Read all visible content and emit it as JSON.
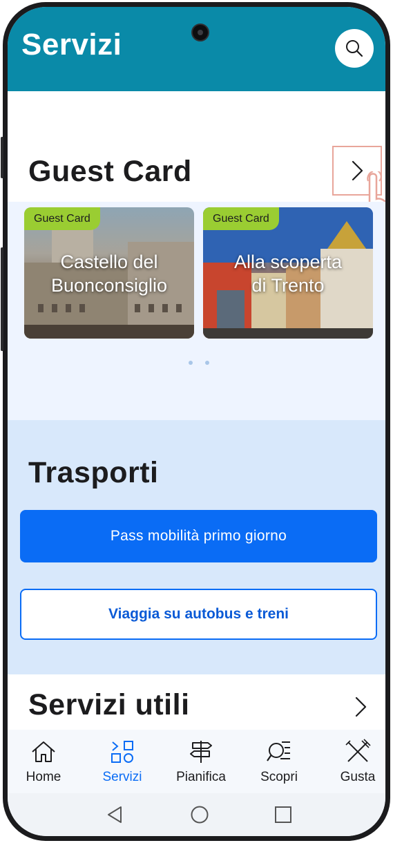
{
  "header": {
    "title": "Servizi"
  },
  "guest_card": {
    "title": "Guest Card",
    "cards": [
      {
        "tag": "Guest Card",
        "title": "Castello del\nBuonconsiglio"
      },
      {
        "tag": "Guest Card",
        "title": "Alla scoperta\ndi Trento"
      }
    ]
  },
  "trasporti": {
    "title": "Trasporti",
    "primary_button": "Pass mobilità primo giorno",
    "secondary_button": "Viaggia su autobus e treni"
  },
  "servizi_utili": {
    "title": "Servizi utili"
  },
  "bottom_nav": {
    "items": [
      {
        "label": "Home",
        "icon": "home-icon"
      },
      {
        "label": "Servizi",
        "icon": "services-icon"
      },
      {
        "label": "Pianifica",
        "icon": "signpost-icon"
      },
      {
        "label": "Scopri",
        "icon": "discover-icon"
      },
      {
        "label": "Gusta",
        "icon": "fork-knife-icon"
      }
    ]
  },
  "colors": {
    "header": "#0a8aa8",
    "primary": "#0a6cf5",
    "tag": "#9acd32",
    "trasporti_bg": "#d8e8fb"
  }
}
